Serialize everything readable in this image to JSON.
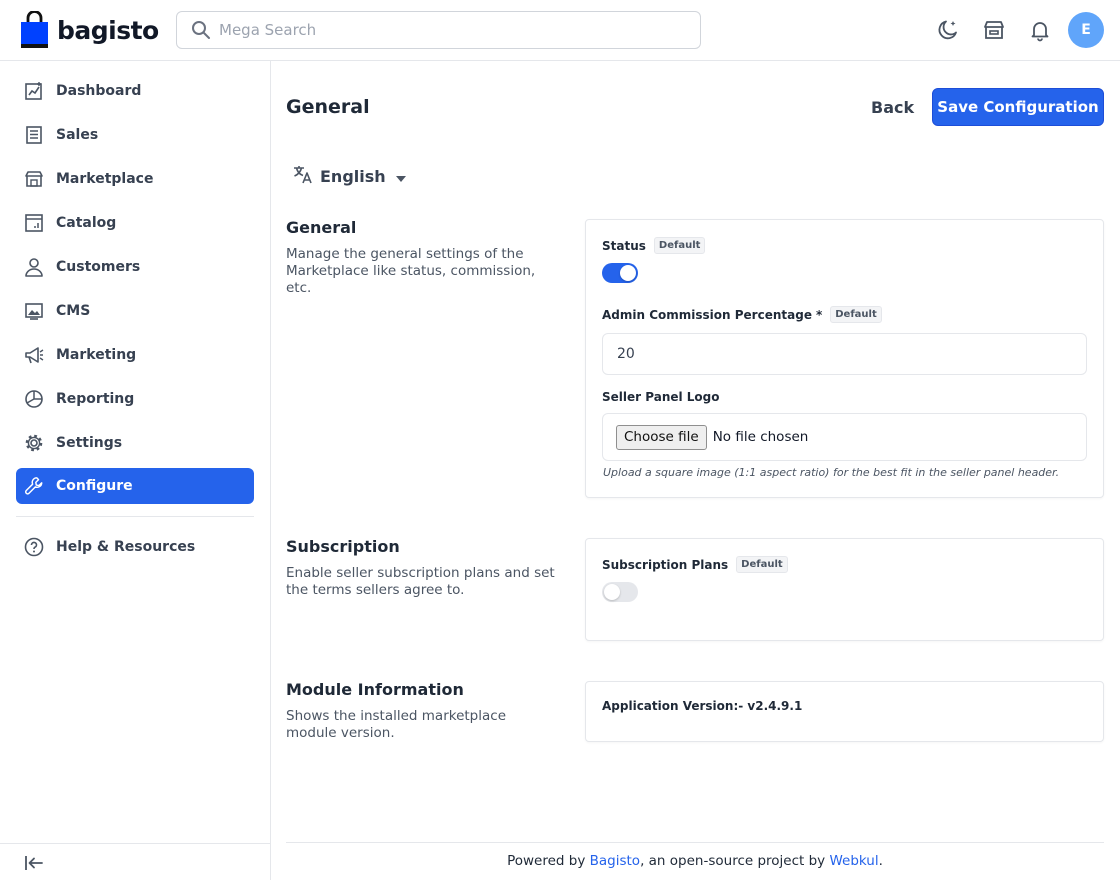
{
  "header": {
    "brand": "bagisto",
    "search_placeholder": "Mega Search",
    "avatar_initial": "E",
    "icons": [
      "dark-mode-icon",
      "storefront-icon",
      "notification-bell-icon"
    ]
  },
  "sidebar": {
    "items": [
      {
        "label": "Dashboard",
        "icon": "dashboard-icon"
      },
      {
        "label": "Sales",
        "icon": "sales-icon"
      },
      {
        "label": "Marketplace",
        "icon": "marketplace-icon"
      },
      {
        "label": "Catalog",
        "icon": "catalog-icon"
      },
      {
        "label": "Customers",
        "icon": "customers-icon"
      },
      {
        "label": "CMS",
        "icon": "cms-icon"
      },
      {
        "label": "Marketing",
        "icon": "marketing-icon"
      },
      {
        "label": "Reporting",
        "icon": "reporting-icon"
      },
      {
        "label": "Settings",
        "icon": "settings-icon"
      },
      {
        "label": "Configure",
        "icon": "configure-icon",
        "active": true
      }
    ],
    "help": {
      "label": "Help & Resources",
      "icon": "help-icon"
    }
  },
  "page": {
    "title": "General",
    "back_label": "Back",
    "save_label": "Save Configuration",
    "locale": "English"
  },
  "sections": {
    "general": {
      "title": "General",
      "description": "Manage the general settings of the Marketplace like status, commission, etc.",
      "status_label": "Status",
      "status_badge": "Default",
      "status_on": true,
      "commission_label": "Admin Commission Percentage",
      "commission_required": "*",
      "commission_badge": "Default",
      "commission_value": "20",
      "logo_label": "Seller Panel Logo",
      "file_button": "Choose file",
      "file_status": "No file chosen",
      "logo_hint": "Upload a square image (1:1 aspect ratio) for the best fit in the seller panel header."
    },
    "subscription": {
      "title": "Subscription",
      "description": "Enable seller subscription plans and set the terms sellers agree to.",
      "plans_label": "Subscription Plans",
      "plans_badge": "Default",
      "plans_on": false
    },
    "module": {
      "title": "Module Information",
      "description": "Shows the installed marketplace module version.",
      "version_text": "Application Version:- v2.4.9.1"
    }
  },
  "footer": {
    "prefix": "Powered by ",
    "link1": "Bagisto",
    "middle": ", an open-source project by ",
    "link2": "Webkul",
    "suffix": "."
  },
  "colors": {
    "accent": "#2563eb",
    "avatar": "#60a5fa"
  }
}
